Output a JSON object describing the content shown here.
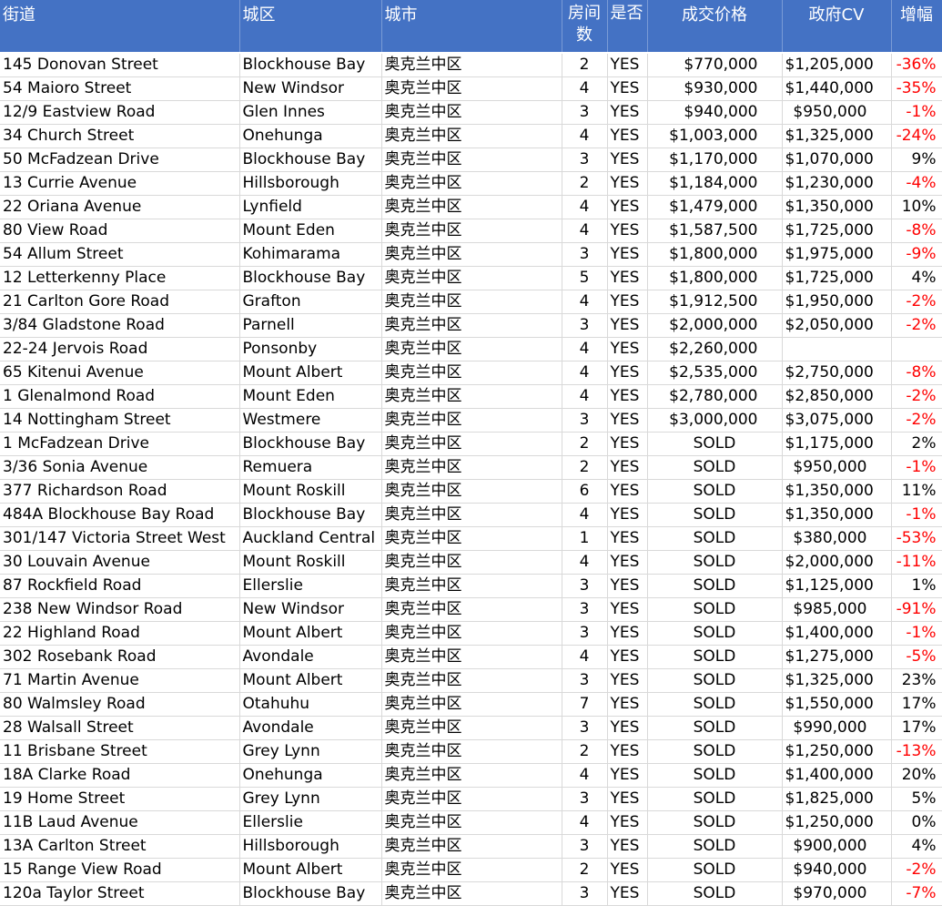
{
  "headers": {
    "street": "街道",
    "suburb": "城区",
    "city": "城市",
    "rooms": "房间数",
    "yesno": "是否",
    "price": "成交价格",
    "cv": "政府CV",
    "change": "增幅"
  },
  "negative_color": "#ff0000",
  "header_color": "#4472c4",
  "rows": [
    {
      "street": "145 Donovan Street",
      "suburb": "Blockhouse Bay",
      "city": "奥克兰中区",
      "rooms": "2",
      "yes": "YES",
      "price": "$770,000",
      "cv": "$1,205,000",
      "change": "-36%"
    },
    {
      "street": "54 Maioro Street",
      "suburb": "New Windsor",
      "city": "奥克兰中区",
      "rooms": "4",
      "yes": "YES",
      "price": "$930,000",
      "cv": "$1,440,000",
      "change": "-35%"
    },
    {
      "street": "12/9 Eastview Road",
      "suburb": "Glen Innes",
      "city": "奥克兰中区",
      "rooms": "3",
      "yes": "YES",
      "price": "$940,000",
      "cv": "$950,000",
      "change": "-1%"
    },
    {
      "street": "34 Church Street",
      "suburb": "Onehunga",
      "city": "奥克兰中区",
      "rooms": "4",
      "yes": "YES",
      "price": "$1,003,000",
      "cv": "$1,325,000",
      "change": "-24%"
    },
    {
      "street": "50 McFadzean Drive",
      "suburb": "Blockhouse Bay",
      "city": "奥克兰中区",
      "rooms": "3",
      "yes": "YES",
      "price": "$1,170,000",
      "cv": "$1,070,000",
      "change": "9%"
    },
    {
      "street": "13 Currie Avenue",
      "suburb": "Hillsborough",
      "city": "奥克兰中区",
      "rooms": "2",
      "yes": "YES",
      "price": "$1,184,000",
      "cv": "$1,230,000",
      "change": "-4%"
    },
    {
      "street": "22 Oriana Avenue",
      "suburb": "Lynfield",
      "city": "奥克兰中区",
      "rooms": "4",
      "yes": "YES",
      "price": "$1,479,000",
      "cv": "$1,350,000",
      "change": "10%"
    },
    {
      "street": "80 View Road",
      "suburb": "Mount Eden",
      "city": "奥克兰中区",
      "rooms": "4",
      "yes": "YES",
      "price": "$1,587,500",
      "cv": "$1,725,000",
      "change": "-8%"
    },
    {
      "street": "54 Allum Street",
      "suburb": "Kohimarama",
      "city": "奥克兰中区",
      "rooms": "3",
      "yes": "YES",
      "price": "$1,800,000",
      "cv": "$1,975,000",
      "change": "-9%"
    },
    {
      "street": "12 Letterkenny Place",
      "suburb": "Blockhouse Bay",
      "city": "奥克兰中区",
      "rooms": "5",
      "yes": "YES",
      "price": "$1,800,000",
      "cv": "$1,725,000",
      "change": "4%"
    },
    {
      "street": "21 Carlton Gore Road",
      "suburb": "Grafton",
      "city": "奥克兰中区",
      "rooms": "4",
      "yes": "YES",
      "price": "$1,912,500",
      "cv": "$1,950,000",
      "change": "-2%"
    },
    {
      "street": "3/84 Gladstone Road",
      "suburb": "Parnell",
      "city": "奥克兰中区",
      "rooms": "3",
      "yes": "YES",
      "price": "$2,000,000",
      "cv": "$2,050,000",
      "change": "-2%"
    },
    {
      "street": "22-24 Jervois Road",
      "suburb": "Ponsonby",
      "city": "奥克兰中区",
      "rooms": "4",
      "yes": "YES",
      "price": "$2,260,000",
      "cv": "",
      "change": ""
    },
    {
      "street": "65 Kitenui Avenue",
      "suburb": "Mount Albert",
      "city": "奥克兰中区",
      "rooms": "4",
      "yes": "YES",
      "price": "$2,535,000",
      "cv": "$2,750,000",
      "change": "-8%"
    },
    {
      "street": "1 Glenalmond Road",
      "suburb": "Mount Eden",
      "city": "奥克兰中区",
      "rooms": "4",
      "yes": "YES",
      "price": "$2,780,000",
      "cv": "$2,850,000",
      "change": "-2%"
    },
    {
      "street": "14 Nottingham Street",
      "suburb": "Westmere",
      "city": "奥克兰中区",
      "rooms": "3",
      "yes": "YES",
      "price": "$3,000,000",
      "cv": "$3,075,000",
      "change": "-2%"
    },
    {
      "street": "1 McFadzean Drive",
      "suburb": "Blockhouse Bay",
      "city": "奥克兰中区",
      "rooms": "2",
      "yes": "YES",
      "price": "SOLD",
      "cv": "$1,175,000",
      "change": "2%"
    },
    {
      "street": "3/36 Sonia Avenue",
      "suburb": "Remuera",
      "city": "奥克兰中区",
      "rooms": "2",
      "yes": "YES",
      "price": "SOLD",
      "cv": "$950,000",
      "change": "-1%"
    },
    {
      "street": "377 Richardson Road",
      "suburb": "Mount Roskill",
      "city": "奥克兰中区",
      "rooms": "6",
      "yes": "YES",
      "price": "SOLD",
      "cv": "$1,350,000",
      "change": "11%"
    },
    {
      "street": "484A Blockhouse Bay Road",
      "suburb": "Blockhouse Bay",
      "city": "奥克兰中区",
      "rooms": "4",
      "yes": "YES",
      "price": "SOLD",
      "cv": "$1,350,000",
      "change": "-1%"
    },
    {
      "street": "301/147 Victoria Street West",
      "suburb": "Auckland Central",
      "city": "奥克兰中区",
      "rooms": "1",
      "yes": "YES",
      "price": "SOLD",
      "cv": "$380,000",
      "change": "-53%"
    },
    {
      "street": "30 Louvain Avenue",
      "suburb": "Mount Roskill",
      "city": "奥克兰中区",
      "rooms": "4",
      "yes": "YES",
      "price": "SOLD",
      "cv": "$2,000,000",
      "change": "-11%"
    },
    {
      "street": "87 Rockfield Road",
      "suburb": "Ellerslie",
      "city": "奥克兰中区",
      "rooms": "3",
      "yes": "YES",
      "price": "SOLD",
      "cv": "$1,125,000",
      "change": "1%"
    },
    {
      "street": "238 New Windsor Road",
      "suburb": "New Windsor",
      "city": "奥克兰中区",
      "rooms": "3",
      "yes": "YES",
      "price": "SOLD",
      "cv": "$985,000",
      "change": "-91%"
    },
    {
      "street": "22 Highland Road",
      "suburb": "Mount Albert",
      "city": "奥克兰中区",
      "rooms": "3",
      "yes": "YES",
      "price": "SOLD",
      "cv": "$1,400,000",
      "change": "-1%"
    },
    {
      "street": "302 Rosebank Road",
      "suburb": "Avondale",
      "city": "奥克兰中区",
      "rooms": "4",
      "yes": "YES",
      "price": "SOLD",
      "cv": "$1,275,000",
      "change": "-5%"
    },
    {
      "street": "71 Martin Avenue",
      "suburb": "Mount Albert",
      "city": "奥克兰中区",
      "rooms": "3",
      "yes": "YES",
      "price": "SOLD",
      "cv": "$1,325,000",
      "change": "23%"
    },
    {
      "street": "80 Walmsley Road",
      "suburb": "Otahuhu",
      "city": "奥克兰中区",
      "rooms": "7",
      "yes": "YES",
      "price": "SOLD",
      "cv": "$1,550,000",
      "change": "17%"
    },
    {
      "street": "28 Walsall Street",
      "suburb": "Avondale",
      "city": "奥克兰中区",
      "rooms": "3",
      "yes": "YES",
      "price": "SOLD",
      "cv": "$990,000",
      "change": "17%"
    },
    {
      "street": "11 Brisbane Street",
      "suburb": "Grey Lynn",
      "city": "奥克兰中区",
      "rooms": "2",
      "yes": "YES",
      "price": "SOLD",
      "cv": "$1,250,000",
      "change": "-13%"
    },
    {
      "street": "18A Clarke Road",
      "suburb": "Onehunga",
      "city": "奥克兰中区",
      "rooms": "4",
      "yes": "YES",
      "price": "SOLD",
      "cv": "$1,400,000",
      "change": "20%"
    },
    {
      "street": "19 Home Street",
      "suburb": "Grey Lynn",
      "city": "奥克兰中区",
      "rooms": "3",
      "yes": "YES",
      "price": "SOLD",
      "cv": "$1,825,000",
      "change": "5%"
    },
    {
      "street": "11B Laud Avenue",
      "suburb": "Ellerslie",
      "city": "奥克兰中区",
      "rooms": "4",
      "yes": "YES",
      "price": "SOLD",
      "cv": "$1,250,000",
      "change": "0%"
    },
    {
      "street": "13A Carlton Street",
      "suburb": "Hillsborough",
      "city": "奥克兰中区",
      "rooms": "3",
      "yes": "YES",
      "price": "SOLD",
      "cv": "$900,000",
      "change": "4%"
    },
    {
      "street": "15 Range View Road",
      "suburb": "Mount Albert",
      "city": "奥克兰中区",
      "rooms": "2",
      "yes": "YES",
      "price": "SOLD",
      "cv": "$940,000",
      "change": "-2%"
    },
    {
      "street": "120a Taylor Street",
      "suburb": "Blockhouse Bay",
      "city": "奥克兰中区",
      "rooms": "3",
      "yes": "YES",
      "price": "SOLD",
      "cv": "$970,000",
      "change": "-7%"
    }
  ]
}
